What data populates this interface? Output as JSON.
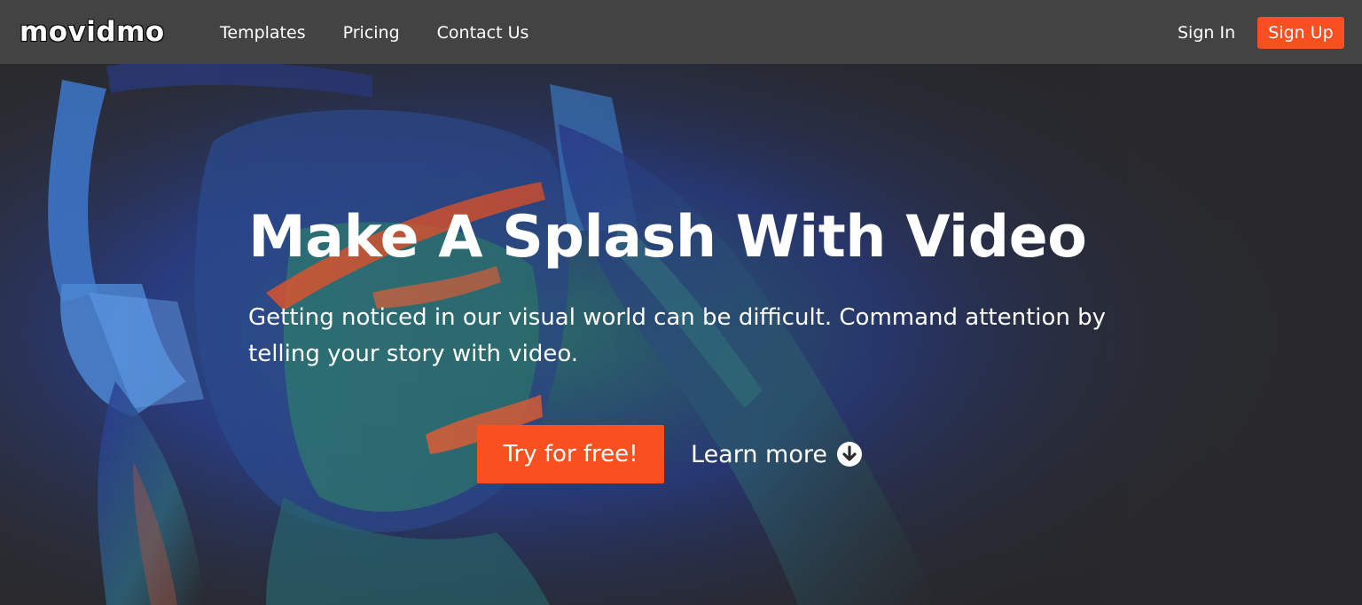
{
  "header": {
    "logo_text": "movidmo",
    "nav": [
      {
        "label": "Templates"
      },
      {
        "label": "Pricing"
      },
      {
        "label": "Contact Us"
      }
    ],
    "sign_in_label": "Sign In",
    "sign_up_label": "Sign Up"
  },
  "hero": {
    "headline": "Make A Splash With Video",
    "subheadline": "Getting noticed in our visual world can be difficult. Command attention by telling your story with video.",
    "primary_cta": "Try for free!",
    "secondary_cta": "Learn more",
    "secondary_cta_icon": "arrow-down-circle-icon",
    "background_image": "person-with-headphones-neon-paint-photo"
  },
  "colors": {
    "accent": "#fa4f1f",
    "header_bg": "#444444",
    "hero_bg": "#2b2b2e",
    "text": "#ffffff"
  }
}
